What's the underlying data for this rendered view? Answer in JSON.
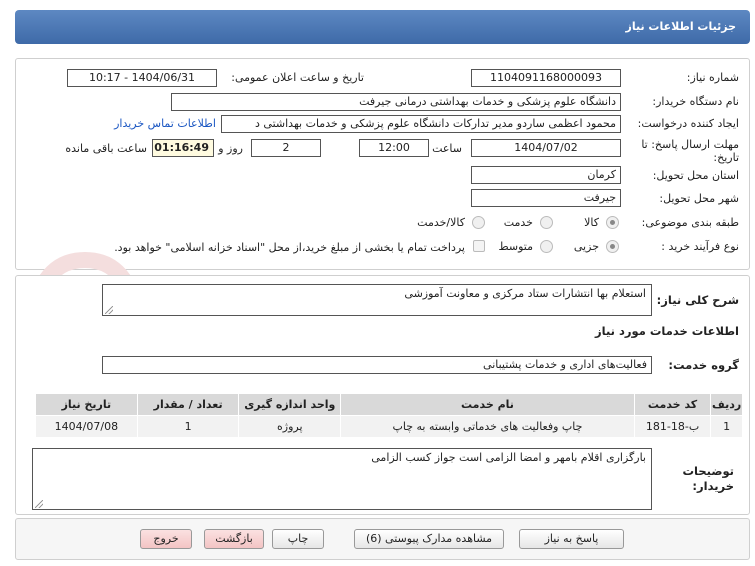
{
  "header": {
    "title": "جزئیات اطلاعات نیاز"
  },
  "fields": {
    "need_number_label": "شماره نیاز:",
    "need_number": "1104091168000093",
    "announce_label": "تاریخ و ساعت اعلان عمومی:",
    "announce_value": "1404/06/31 - 10:17",
    "buyer_org_label": "نام دستگاه خریدار:",
    "buyer_org": "دانشگاه علوم پزشکی و خدمات بهداشتی درمانی جیرفت",
    "creator_label": "ایجاد کننده درخواست:",
    "creator": "محمود اعظمی ساردو مدیر تدارکات دانشگاه علوم پزشکی و خدمات بهداشتی د",
    "buyer_contact_link": "اطلاعات تماس خریدار",
    "deadline_label_1": "مهلت ارسال پاسخ: تا",
    "deadline_label_2": "تاریخ:",
    "deadline_date": "1404/07/02",
    "hour_label": "ساعت",
    "deadline_time": "12:00",
    "days": "2",
    "days_label": "روز و",
    "remaining": "01:16:49",
    "remaining_label": "ساعت باقی مانده",
    "province_label": "استان محل تحویل:",
    "province": "کرمان",
    "city_label": "شهر محل تحویل:",
    "city": "جیرفت",
    "category_label": "طبقه بندی موضوعی:",
    "category_options": [
      "کالا",
      "خدمت",
      "کالا/خدمت"
    ],
    "process_label": "نوع فرآیند خرید :",
    "process_options": [
      "جزیی",
      "متوسط"
    ],
    "payment_note": "پرداخت تمام یا بخشی از مبلغ خرید،از محل \"اسناد خزانه اسلامی\" خواهد بود."
  },
  "summary": {
    "label": "شرح کلی نیاز:",
    "value": "استعلام بها انتشارات ستاد مرکزی و معاونت آموزشی"
  },
  "services": {
    "section_title": "اطلاعات خدمات مورد نیاز",
    "group_label": "گروه خدمت:",
    "group_value": "فعالیت‌های اداری و خدمات پشتیبانی",
    "columns": [
      "ردیف",
      "کد خدمت",
      "نام خدمت",
      "واحد اندازه گیری",
      "تعداد / مقدار",
      "تاریخ نیاز"
    ],
    "rows": [
      [
        "1",
        "ب-18-181",
        "چاپ وفعالیت های خدماتی وابسته به چاپ",
        "پروژه",
        "1",
        "1404/07/08"
      ]
    ]
  },
  "notes": {
    "label_1": "توضیحات",
    "label_2": "خریدار:",
    "value": "بارگزاری اقلام بامهر و امضا الزامی است جواز کسب الزامی"
  },
  "buttons": {
    "reply": "پاسخ به نیاز",
    "attachments": "مشاهده مدارک پیوستی (6)",
    "print": "چاپ",
    "back": "بازگشت",
    "exit": "خروج"
  },
  "watermark": {
    "text": "AriaTender.neT"
  },
  "colors": {
    "title_bar": "#4a76b3",
    "link": "#1a56c2",
    "remaining_bg": "#fffbe0",
    "danger_btn": "#f3c4c4"
  }
}
